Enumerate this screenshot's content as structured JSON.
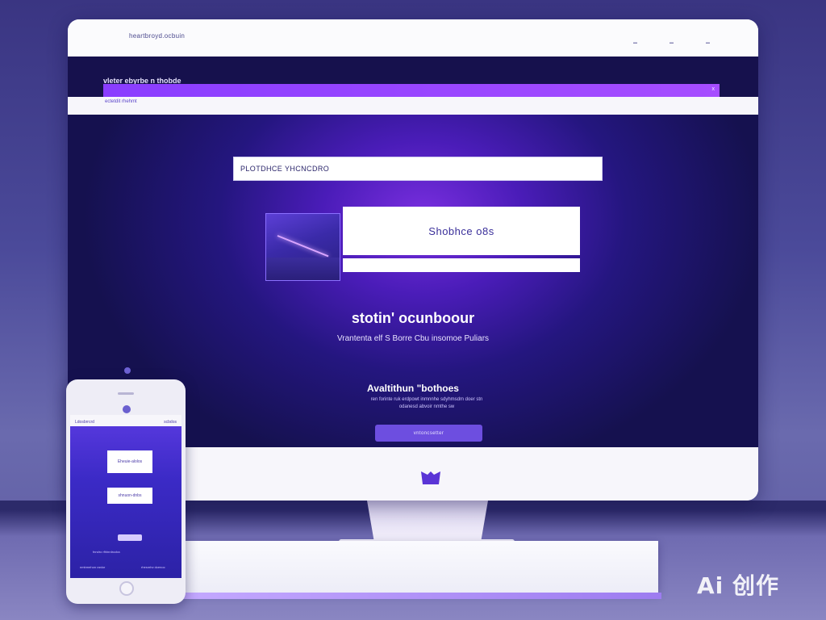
{
  "browser": {
    "url": "heartbroyd.ocbuin",
    "menu": [
      "",
      "",
      ""
    ]
  },
  "site": {
    "title": "vleter ebyrbe n thobde",
    "nav_link": "ectetdit rhehmt",
    "nav_close": "x"
  },
  "search": {
    "value": "PLOTDHCE YHCNCDRO"
  },
  "featured": {
    "title": "Shobhce o8s"
  },
  "hero": {
    "heading": "stotin' ocunboour",
    "subheading": "Vrantenta elf S Borre Cbu insomoe Puliars"
  },
  "section": {
    "heading": "Avaltithun \"bothoes",
    "text": "ren forinte ruk erdpowt inmnnhe sdyhmsdm doer stn odanesd abvoir nmthe sw",
    "cta_label": "vntoncsetter"
  },
  "phone": {
    "title_left": "Ldosbrrcrd",
    "title_right": "scbdos",
    "card1": "Eheuie-alolos",
    "card2": "shnuon-dnbs",
    "foot1": "fnndro rfhlnrdrccba",
    "foot2": "nmbmehon ranlor",
    "foot3": "rhesnrbv dcenoc"
  },
  "watermark": "Ai 创作",
  "colors": {
    "accent": "#6d4ee0",
    "screen_dark": "#15114f",
    "nav_strip": "#8a3dff"
  }
}
